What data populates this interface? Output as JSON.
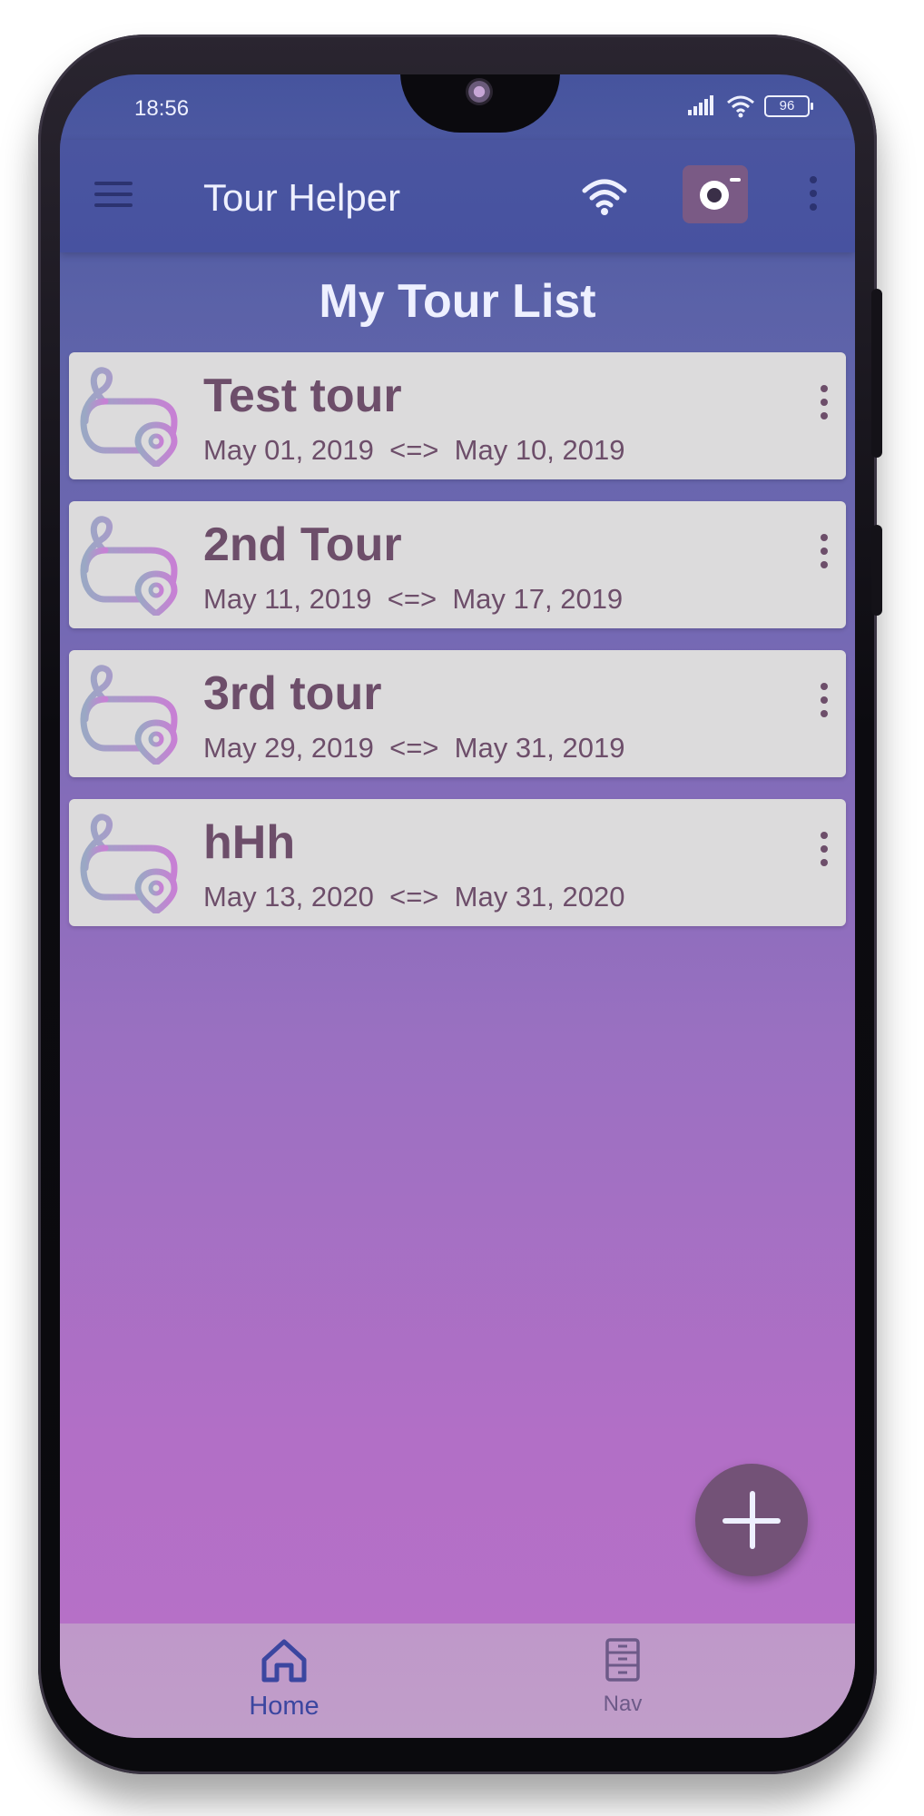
{
  "status_bar": {
    "time": "18:56",
    "battery": "96"
  },
  "app_bar": {
    "title": "Tour Helper"
  },
  "page": {
    "title": "My Tour List"
  },
  "tours": [
    {
      "name": "Test tour",
      "start": "May 01, 2019",
      "separator": "<=>",
      "end": "May 10, 2019"
    },
    {
      "name": "2nd Tour",
      "start": "May 11, 2019",
      "separator": "<=>",
      "end": "May 17, 2019"
    },
    {
      "name": "3rd tour",
      "start": "May 29, 2019",
      "separator": "<=>",
      "end": "May 31, 2019"
    },
    {
      "name": "hHh",
      "start": "May 13, 2020",
      "separator": "<=>",
      "end": "May 31, 2020"
    }
  ],
  "bottom_nav": [
    {
      "label": "Home",
      "icon": "home-icon",
      "active": true
    },
    {
      "label": "Nav",
      "icon": "cabinet-icon",
      "active": false
    }
  ],
  "icons": {
    "menu": "menu-icon",
    "wifi": "wifi-icon",
    "camera": "camera-icon",
    "overflow": "more-vert-icon",
    "tour": "map-route-icon",
    "add": "plus-icon"
  },
  "colors": {
    "app_bar": "#4752a0",
    "card": "#dcdbdc",
    "card_text": "#6d4e6a",
    "fab": "#735277",
    "nav_active": "#3b46a0",
    "nav_inactive": "#6d5a88"
  }
}
